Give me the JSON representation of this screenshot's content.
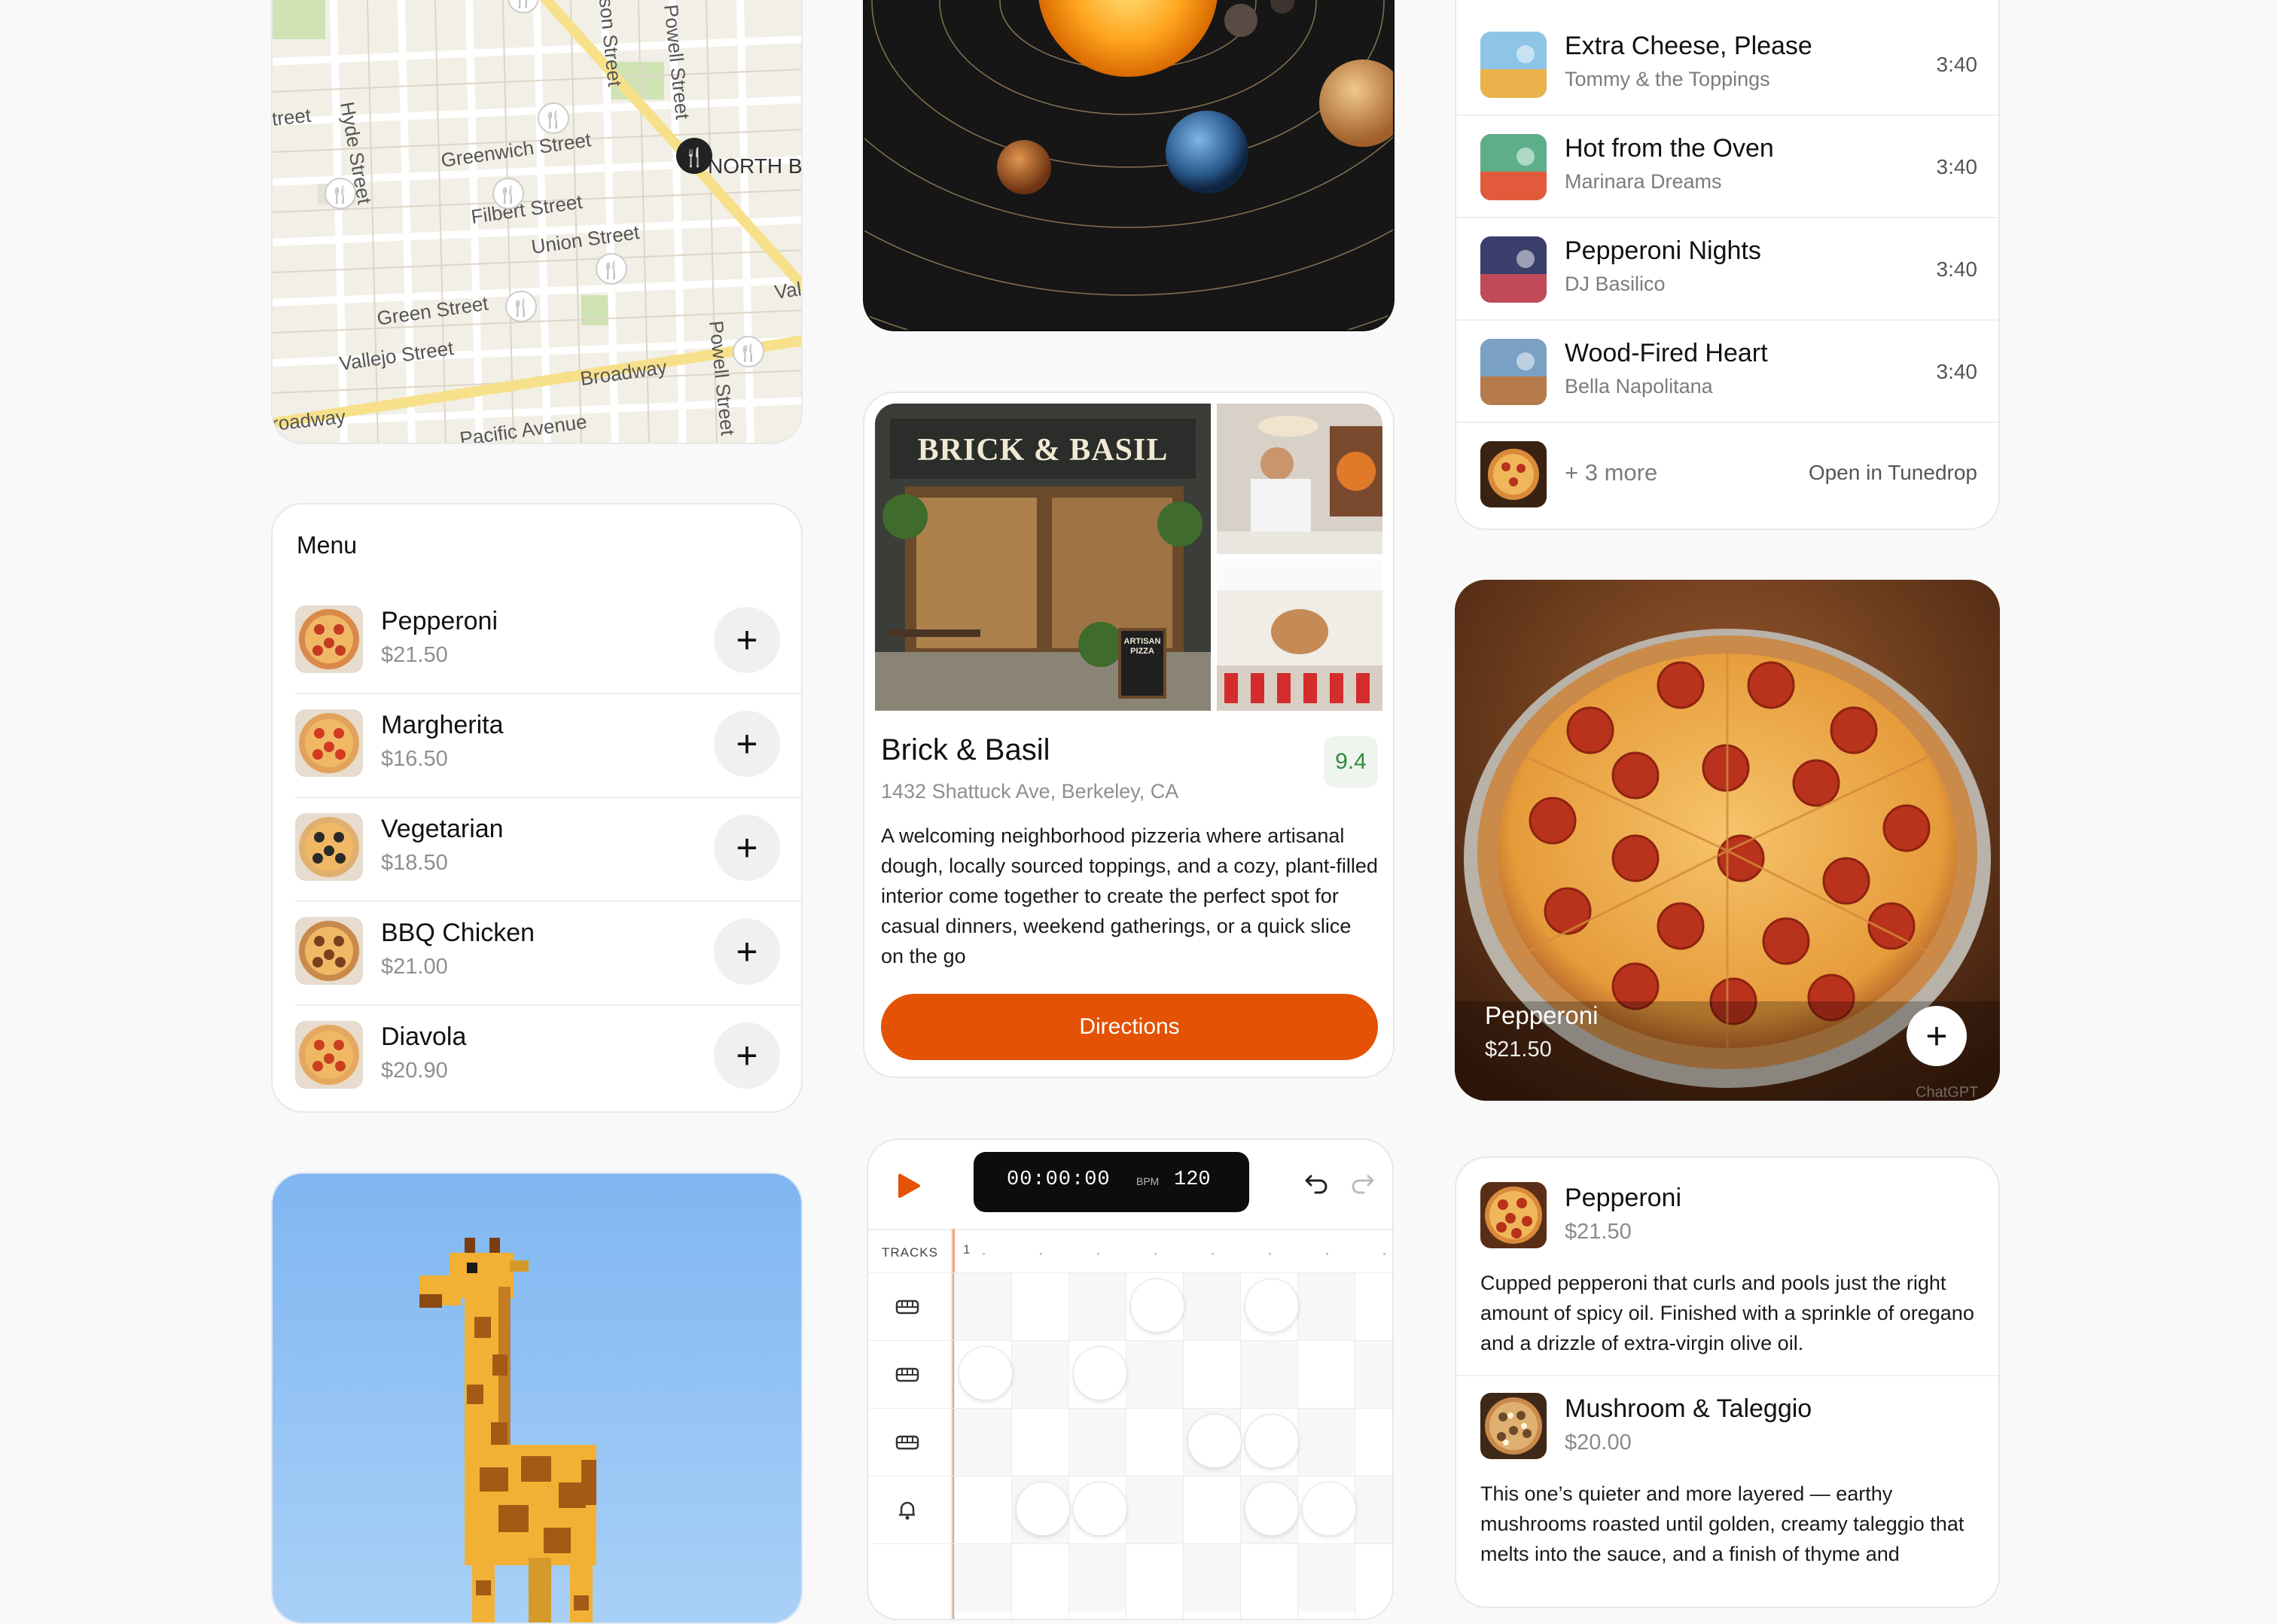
{
  "map": {
    "streets": [
      "Hyde Street",
      "Greenwich Street",
      "Filbert Street",
      "Union Street",
      "Green Street",
      "Vallejo Street",
      "Broadway",
      "Pacific Avenue",
      "Powell Street",
      "Powell Street",
      "Mason Street",
      "treet",
      "roadway",
      "NORTH BE",
      "Val"
    ]
  },
  "menu": {
    "title": "Menu",
    "items": [
      {
        "name": "Pepperoni",
        "price": "$21.50"
      },
      {
        "name": "Margherita",
        "price": "$16.50"
      },
      {
        "name": "Vegetarian",
        "price": "$18.50"
      },
      {
        "name": "BBQ Chicken",
        "price": "$21.00"
      },
      {
        "name": "Diavola",
        "price": "$20.90"
      }
    ],
    "add_label": "+"
  },
  "restaurant": {
    "sign": "BRICK & BASIL",
    "chalkboard": "ARTISAN PIZZA",
    "name": "Brick & Basil",
    "score": "9.4",
    "address": "1432 Shattuck Ave, Berkeley, CA",
    "description": "A welcoming neighborhood pizzeria where artisanal dough, locally sourced toppings, and a cozy, plant-filled interior come together to create the perfect spot for casual dinners, weekend gatherings, or a quick slice on the go",
    "directions_label": "Directions",
    "accent": "#e35205"
  },
  "playlist": {
    "tracks": [
      {
        "title": "Extra Cheese, Please",
        "artist": "Tommy & the Toppings",
        "duration": "3:40"
      },
      {
        "title": "Hot from the Oven",
        "artist": "Marinara Dreams",
        "duration": "3:40"
      },
      {
        "title": "Pepperoni Nights",
        "artist": "DJ Basilico",
        "duration": "3:40"
      },
      {
        "title": "Wood-Fired Heart",
        "artist": "Bella Napolitana",
        "duration": "3:40"
      }
    ],
    "more_label": "+ 3 more",
    "open_label": "Open in Tunedrop"
  },
  "feature": {
    "name": "Pepperoni",
    "price": "$21.50",
    "watermark": "ChatGPT",
    "add_label": "+"
  },
  "sequencer": {
    "time": "00:00:00",
    "bpm_label": "BPM",
    "bpm": "120",
    "tracks_label": "TRACKS",
    "bar_number": "1",
    "track_icons": [
      "keyboard-icon",
      "keyboard-icon",
      "keyboard-icon",
      "bell-icon"
    ]
  },
  "details": {
    "items": [
      {
        "name": "Pepperoni",
        "price": "$21.50",
        "description": "Cupped pepperoni that curls and pools just the right amount of spicy oil. Finished with a sprinkle of oregano and a drizzle of extra-virgin olive oil."
      },
      {
        "name": "Mushroom & Taleggio",
        "price": "$20.00",
        "description": "This one’s quieter and more layered — earthy mushrooms roasted until golden, creamy taleggio that melts into the sauce, and a finish of thyme and"
      }
    ]
  }
}
